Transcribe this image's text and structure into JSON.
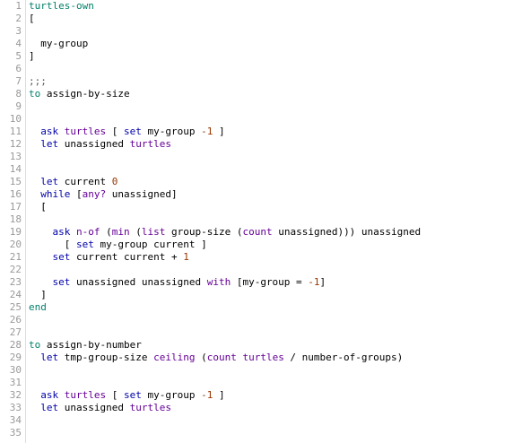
{
  "colors": {
    "keyword": "#007f69",
    "command": "#0000aa",
    "reporter": "#660096",
    "constant": "#963700",
    "comment": "#5a5a5a",
    "plain": "#000000",
    "line_number": "#999999",
    "gutter_border": "#dddddd",
    "background": "#ffffff"
  },
  "lines": [
    {
      "n": "1",
      "tokens": [
        {
          "t": "turtles-own",
          "c": "keyword"
        }
      ]
    },
    {
      "n": "2",
      "tokens": [
        {
          "t": "[",
          "c": "plain"
        }
      ]
    },
    {
      "n": "3",
      "tokens": []
    },
    {
      "n": "4",
      "tokens": [
        {
          "t": "  my-group",
          "c": "plain"
        }
      ]
    },
    {
      "n": "5",
      "tokens": [
        {
          "t": "]",
          "c": "plain"
        }
      ]
    },
    {
      "n": "6",
      "tokens": []
    },
    {
      "n": "7",
      "tokens": [
        {
          "t": ";;;",
          "c": "comment"
        }
      ]
    },
    {
      "n": "8",
      "tokens": [
        {
          "t": "to",
          "c": "keyword"
        },
        {
          "t": " assign-by-size",
          "c": "plain"
        }
      ]
    },
    {
      "n": "9",
      "tokens": []
    },
    {
      "n": "10",
      "tokens": []
    },
    {
      "n": "11",
      "tokens": [
        {
          "t": "  ",
          "c": "plain"
        },
        {
          "t": "ask",
          "c": "command"
        },
        {
          "t": " ",
          "c": "plain"
        },
        {
          "t": "turtles",
          "c": "reporter"
        },
        {
          "t": " [ ",
          "c": "plain"
        },
        {
          "t": "set",
          "c": "command"
        },
        {
          "t": " my-group ",
          "c": "plain"
        },
        {
          "t": "-1",
          "c": "constant"
        },
        {
          "t": " ]",
          "c": "plain"
        }
      ]
    },
    {
      "n": "12",
      "tokens": [
        {
          "t": "  ",
          "c": "plain"
        },
        {
          "t": "let",
          "c": "command"
        },
        {
          "t": " unassigned ",
          "c": "plain"
        },
        {
          "t": "turtles",
          "c": "reporter"
        }
      ]
    },
    {
      "n": "13",
      "tokens": []
    },
    {
      "n": "14",
      "tokens": []
    },
    {
      "n": "15",
      "tokens": [
        {
          "t": "  ",
          "c": "plain"
        },
        {
          "t": "let",
          "c": "command"
        },
        {
          "t": " current ",
          "c": "plain"
        },
        {
          "t": "0",
          "c": "constant"
        }
      ]
    },
    {
      "n": "16",
      "tokens": [
        {
          "t": "  ",
          "c": "plain"
        },
        {
          "t": "while",
          "c": "command"
        },
        {
          "t": " [",
          "c": "plain"
        },
        {
          "t": "any?",
          "c": "reporter"
        },
        {
          "t": " unassigned]",
          "c": "plain"
        }
      ]
    },
    {
      "n": "17",
      "tokens": [
        {
          "t": "  [",
          "c": "plain"
        }
      ]
    },
    {
      "n": "18",
      "tokens": []
    },
    {
      "n": "19",
      "tokens": [
        {
          "t": "    ",
          "c": "plain"
        },
        {
          "t": "ask",
          "c": "command"
        },
        {
          "t": " ",
          "c": "plain"
        },
        {
          "t": "n-of",
          "c": "reporter"
        },
        {
          "t": " (",
          "c": "plain"
        },
        {
          "t": "min",
          "c": "reporter"
        },
        {
          "t": " (",
          "c": "plain"
        },
        {
          "t": "list",
          "c": "reporter"
        },
        {
          "t": " group-size (",
          "c": "plain"
        },
        {
          "t": "count",
          "c": "reporter"
        },
        {
          "t": " unassigned))) unassigned",
          "c": "plain"
        }
      ]
    },
    {
      "n": "20",
      "tokens": [
        {
          "t": "      [ ",
          "c": "plain"
        },
        {
          "t": "set",
          "c": "command"
        },
        {
          "t": " my-group current ]",
          "c": "plain"
        }
      ]
    },
    {
      "n": "21",
      "tokens": [
        {
          "t": "    ",
          "c": "plain"
        },
        {
          "t": "set",
          "c": "command"
        },
        {
          "t": " current current + ",
          "c": "plain"
        },
        {
          "t": "1",
          "c": "constant"
        }
      ]
    },
    {
      "n": "22",
      "tokens": []
    },
    {
      "n": "23",
      "tokens": [
        {
          "t": "    ",
          "c": "plain"
        },
        {
          "t": "set",
          "c": "command"
        },
        {
          "t": " unassigned unassigned ",
          "c": "plain"
        },
        {
          "t": "with",
          "c": "reporter"
        },
        {
          "t": " [my-group = ",
          "c": "plain"
        },
        {
          "t": "-1",
          "c": "constant"
        },
        {
          "t": "]",
          "c": "plain"
        }
      ]
    },
    {
      "n": "24",
      "tokens": [
        {
          "t": "  ]",
          "c": "plain"
        }
      ]
    },
    {
      "n": "25",
      "tokens": [
        {
          "t": "end",
          "c": "keyword"
        }
      ]
    },
    {
      "n": "26",
      "tokens": []
    },
    {
      "n": "27",
      "tokens": []
    },
    {
      "n": "28",
      "tokens": [
        {
          "t": "to",
          "c": "keyword"
        },
        {
          "t": " assign-by-number",
          "c": "plain"
        }
      ]
    },
    {
      "n": "29",
      "tokens": [
        {
          "t": "  ",
          "c": "plain"
        },
        {
          "t": "let",
          "c": "command"
        },
        {
          "t": " tmp-group-size ",
          "c": "plain"
        },
        {
          "t": "ceiling",
          "c": "reporter"
        },
        {
          "t": " (",
          "c": "plain"
        },
        {
          "t": "count",
          "c": "reporter"
        },
        {
          "t": " ",
          "c": "plain"
        },
        {
          "t": "turtles",
          "c": "reporter"
        },
        {
          "t": " / number-of-groups)",
          "c": "plain"
        }
      ]
    },
    {
      "n": "30",
      "tokens": []
    },
    {
      "n": "31",
      "tokens": []
    },
    {
      "n": "32",
      "tokens": [
        {
          "t": "  ",
          "c": "plain"
        },
        {
          "t": "ask",
          "c": "command"
        },
        {
          "t": " ",
          "c": "plain"
        },
        {
          "t": "turtles",
          "c": "reporter"
        },
        {
          "t": " [ ",
          "c": "plain"
        },
        {
          "t": "set",
          "c": "command"
        },
        {
          "t": " my-group ",
          "c": "plain"
        },
        {
          "t": "-1",
          "c": "constant"
        },
        {
          "t": " ]",
          "c": "plain"
        }
      ]
    },
    {
      "n": "33",
      "tokens": [
        {
          "t": "  ",
          "c": "plain"
        },
        {
          "t": "let",
          "c": "command"
        },
        {
          "t": " unassigned ",
          "c": "plain"
        },
        {
          "t": "turtles",
          "c": "reporter"
        }
      ]
    },
    {
      "n": "34",
      "tokens": []
    },
    {
      "n": "35",
      "tokens": []
    }
  ]
}
